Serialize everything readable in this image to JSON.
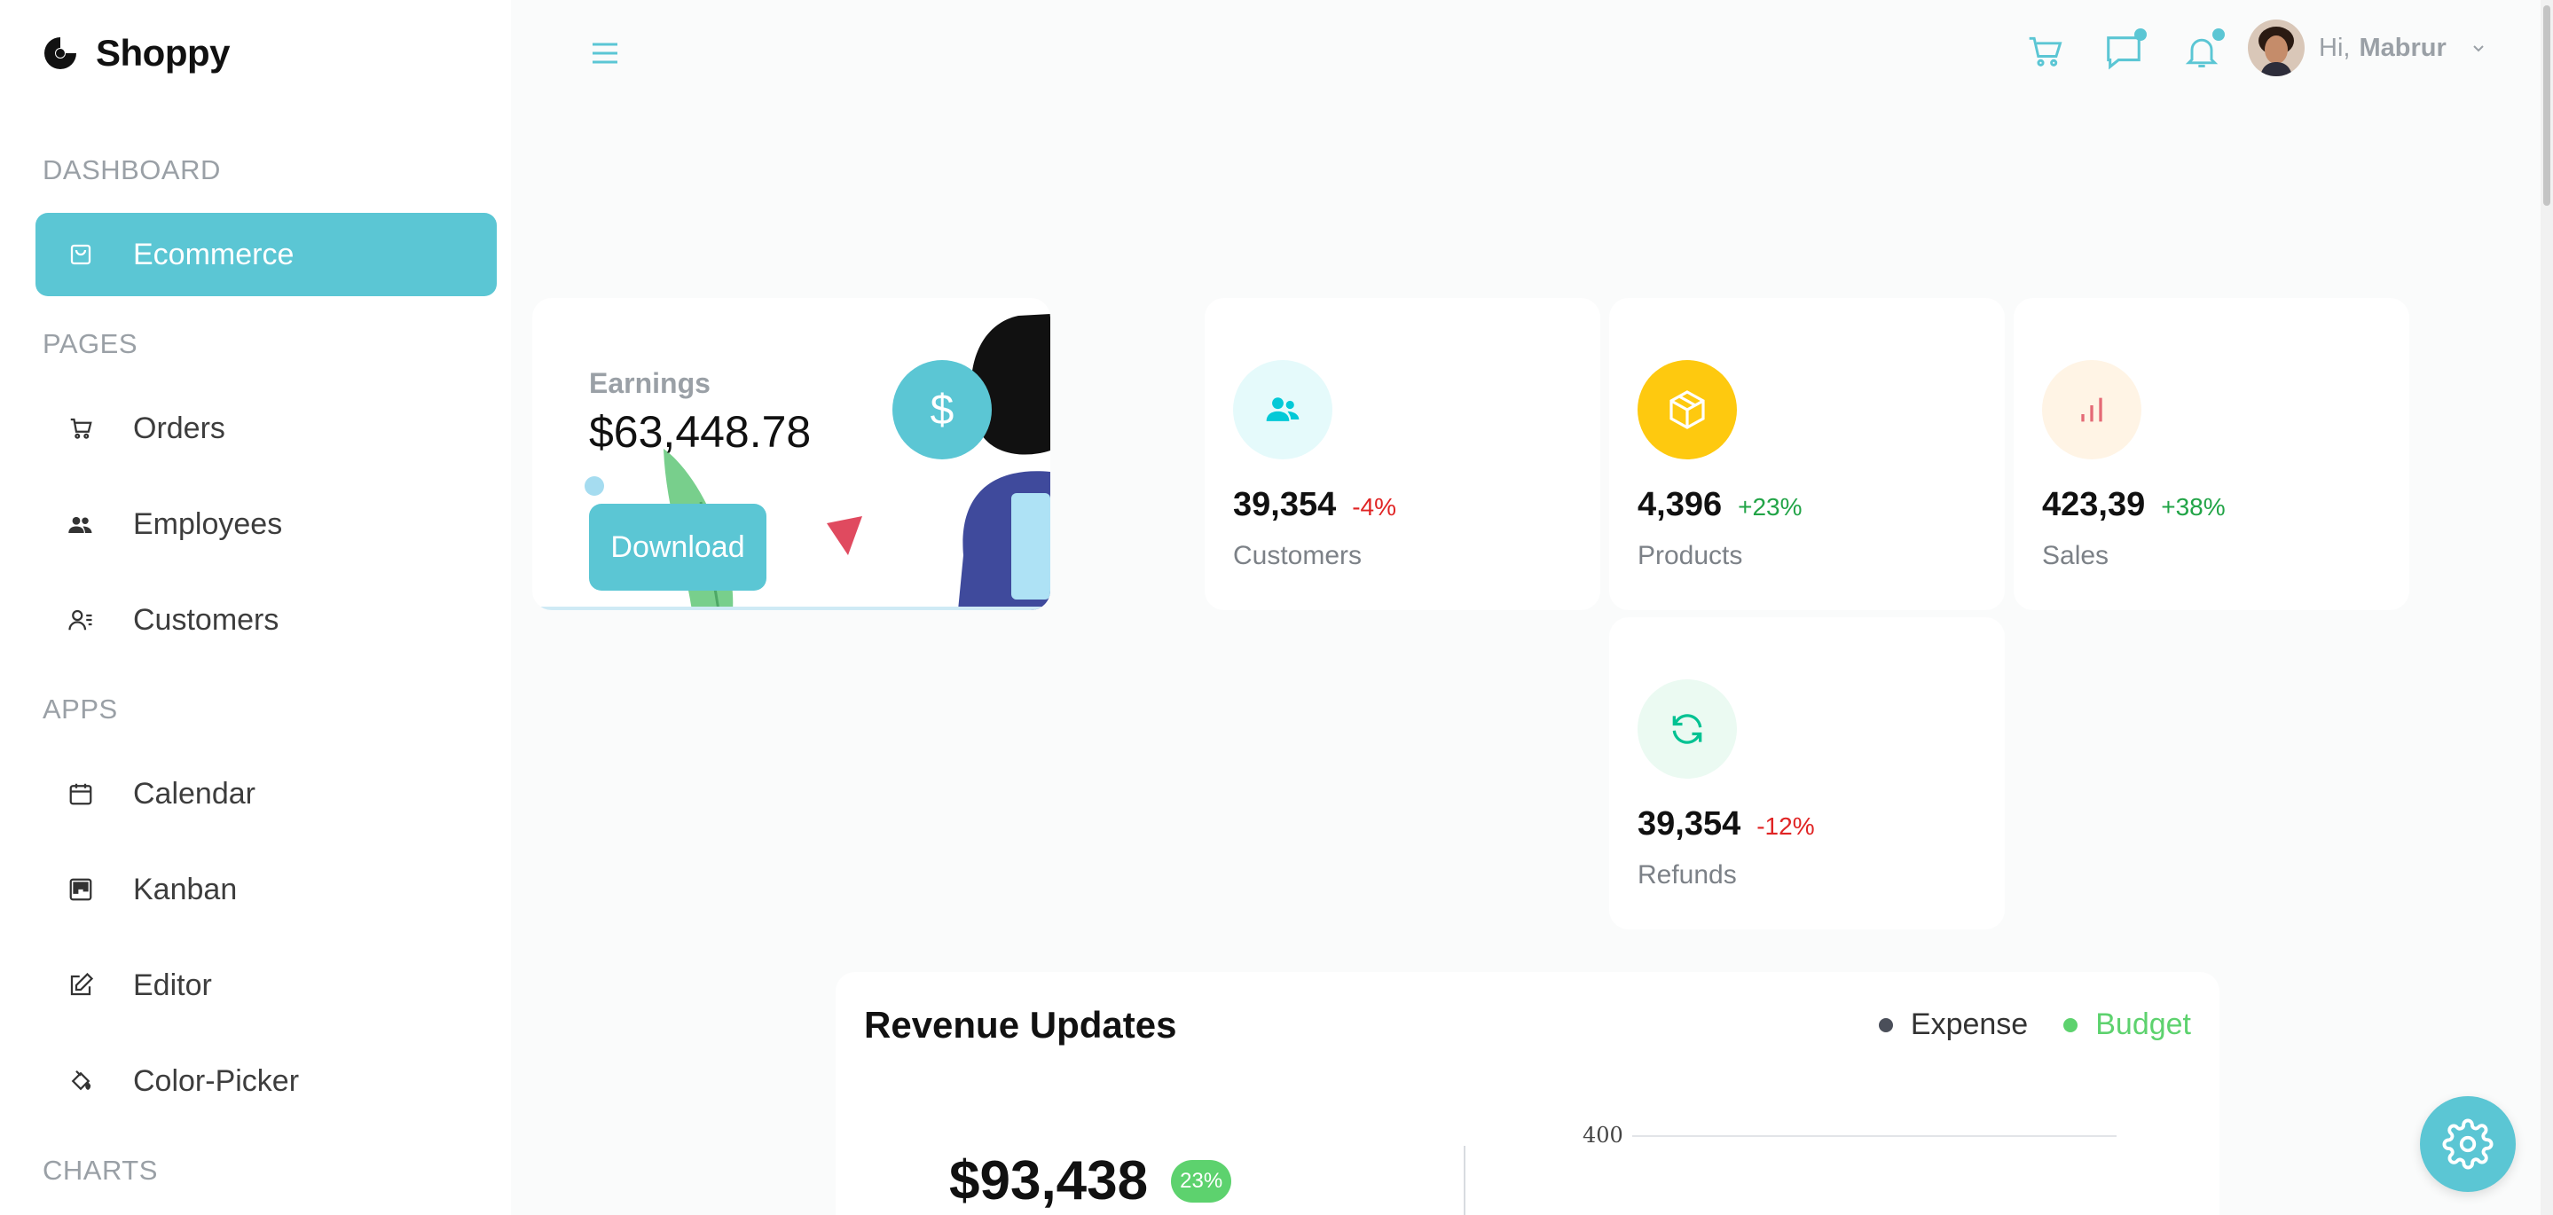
{
  "app": {
    "name": "Shoppy"
  },
  "sidebar": {
    "sections": [
      {
        "title": "DASHBOARD"
      },
      {
        "title": "PAGES"
      },
      {
        "title": "APPS"
      },
      {
        "title": "CHARTS"
      }
    ],
    "items": [
      {
        "label": "Ecommerce",
        "icon": "shopping-bag-icon",
        "active": true
      },
      {
        "label": "Orders",
        "icon": "cart-icon"
      },
      {
        "label": "Employees",
        "icon": "people-icon"
      },
      {
        "label": "Customers",
        "icon": "customer-list-icon"
      },
      {
        "label": "Calendar",
        "icon": "calendar-icon"
      },
      {
        "label": "Kanban",
        "icon": "kanban-icon"
      },
      {
        "label": "Editor",
        "icon": "edit-icon"
      },
      {
        "label": "Color-Picker",
        "icon": "paint-bucket-icon"
      }
    ]
  },
  "header": {
    "greeting": "Hi,",
    "username": "Mabrur"
  },
  "earnings": {
    "label": "Earnings",
    "value": "$63,448.78",
    "button": "Download",
    "badge_symbol": "$"
  },
  "stats": [
    {
      "value": "39,354",
      "change": "-4%",
      "label": "Customers",
      "icon": "customers-icon",
      "icon_color": "#03C9D7",
      "icon_bg": "#E5FAFB",
      "trend": "negative"
    },
    {
      "value": "4,396",
      "change": "+23%",
      "label": "Products",
      "icon": "box-icon",
      "icon_color": "#ffffff",
      "icon_bg": "#FEC90F",
      "trend": "positive"
    },
    {
      "value": "423,39",
      "change": "+38%",
      "label": "Sales",
      "icon": "bar-chart-icon",
      "icon_color": "#E46A76",
      "icon_bg": "#FFF4E5",
      "trend": "positive"
    },
    {
      "value": "39,354",
      "change": "-12%",
      "label": "Refunds",
      "icon": "refresh-icon",
      "icon_color": "#00C292",
      "icon_bg": "#EBFAF2",
      "trend": "negative"
    }
  ],
  "revenue": {
    "title": "Revenue Updates",
    "legend": [
      {
        "label": "Expense",
        "color": "#4b4f5a"
      },
      {
        "label": "Budget",
        "color": "#5dd26e"
      }
    ],
    "total": "$93,438",
    "badge": "23%",
    "tick": "400"
  },
  "colors": {
    "accent": "#5bc6d4"
  }
}
